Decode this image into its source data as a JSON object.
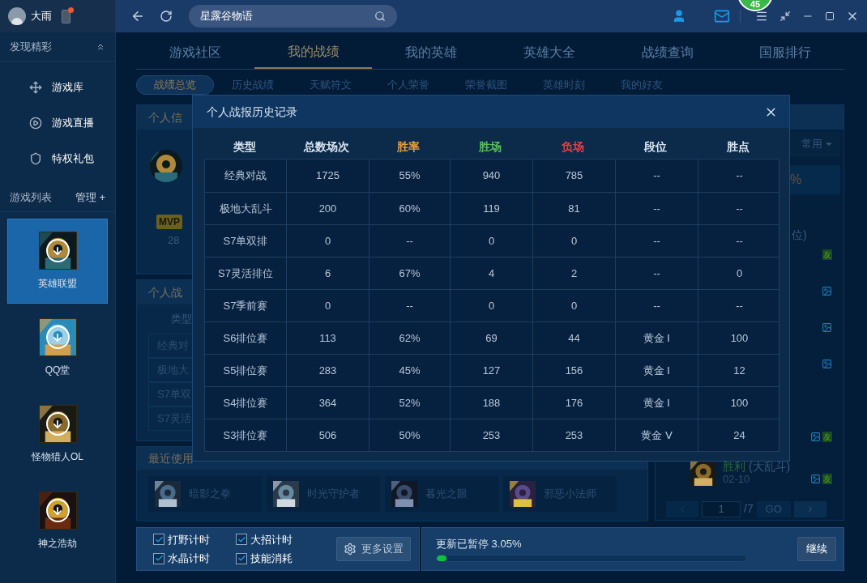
{
  "user": {
    "name": "大雨",
    "notification": true
  },
  "search": {
    "value": "星露谷物语"
  },
  "level_badge": "45",
  "sidebar": {
    "discover": {
      "title": "发现精彩",
      "expanded": true
    },
    "items": [
      "游戏库",
      "游戏直播",
      "特权礼包"
    ],
    "games_header": {
      "title": "游戏列表",
      "manage": "管理 +"
    },
    "games": [
      {
        "name": "英雄联盟",
        "selected": true
      },
      {
        "name": "QQ堂",
        "selected": false
      },
      {
        "name": "怪物猎人OL",
        "selected": false
      },
      {
        "name": "神之浩劫",
        "selected": false
      }
    ]
  },
  "nav_tabs": [
    {
      "label": "游戏社区",
      "selected": false
    },
    {
      "label": "我的战绩",
      "selected": true
    },
    {
      "label": "我的英雄",
      "selected": false
    },
    {
      "label": "英雄大全",
      "selected": false
    },
    {
      "label": "战绩查询",
      "selected": false
    },
    {
      "label": "国服排行",
      "selected": false
    }
  ],
  "sub_tabs": [
    {
      "label": "战绩总览",
      "selected": true
    },
    {
      "label": "历史战绩",
      "selected": false
    },
    {
      "label": "天赋符文",
      "selected": false
    },
    {
      "label": "个人荣誉",
      "selected": false
    },
    {
      "label": "荣誉截图",
      "selected": false
    },
    {
      "label": "英雄时刻",
      "selected": false
    },
    {
      "label": "我的好友",
      "selected": false
    }
  ],
  "profile_card": {
    "title": "个人信",
    "mvp": "MVP",
    "mvp_count": "28"
  },
  "report_card": {
    "title": "个人战",
    "column": "类型",
    "rows": [
      "经典对",
      "极地大",
      "S7单双",
      "S7灵活"
    ]
  },
  "recent": {
    "title": "最近使用",
    "heroes": [
      "暗影之拳",
      "时光守护者",
      "暮光之眼",
      "邪恶小法师"
    ]
  },
  "right_panel": {
    "filter": "常用",
    "summary": "%",
    "rows": [
      {
        "text": "位)",
        "screenshot": false,
        "tag": "友"
      },
      {
        "screenshot": true
      },
      {
        "screenshot": true
      },
      {
        "screenshot": true
      },
      {
        "screenshot": false
      },
      {
        "screenshot": true,
        "tag": "友"
      }
    ],
    "match": {
      "result": "胜利",
      "mode": "(大乱斗)",
      "date": "02-10",
      "screenshot": true,
      "tag": "友"
    },
    "pagination": {
      "page": "1",
      "total": "/7",
      "go": "GO"
    }
  },
  "modal": {
    "title": "个人战报历史记录",
    "columns": [
      {
        "label": "类型",
        "color": "#d8e4f0"
      },
      {
        "label": "总数场次",
        "color": "#d8e4f0"
      },
      {
        "label": "胜率",
        "color": "#e8a040"
      },
      {
        "label": "胜场",
        "color": "#5cc060"
      },
      {
        "label": "负场",
        "color": "#e84040"
      },
      {
        "label": "段位",
        "color": "#d8e4f0"
      },
      {
        "label": "胜点",
        "color": "#d8e4f0"
      }
    ],
    "rows": [
      [
        "经典对战",
        "1725",
        "55%",
        "940",
        "785",
        "--",
        "--"
      ],
      [
        "极地大乱斗",
        "200",
        "60%",
        "119",
        "81",
        "--",
        "--"
      ],
      [
        "S7单双排",
        "0",
        "--",
        "0",
        "0",
        "--",
        "--"
      ],
      [
        "S7灵活排位",
        "6",
        "67%",
        "4",
        "2",
        "--",
        "0"
      ],
      [
        "S7季前赛",
        "0",
        "--",
        "0",
        "0",
        "--",
        "--"
      ],
      [
        "S6排位赛",
        "113",
        "62%",
        "69",
        "44",
        "黄金 Ⅰ",
        "100"
      ],
      [
        "S5排位赛",
        "283",
        "45%",
        "127",
        "156",
        "黄金 Ⅰ",
        "12"
      ],
      [
        "S4排位赛",
        "364",
        "52%",
        "188",
        "176",
        "黄金 Ⅰ",
        "100"
      ],
      [
        "S3排位赛",
        "506",
        "50%",
        "253",
        "253",
        "黄金 Ⅴ",
        "24"
      ]
    ]
  },
  "settings": [
    {
      "label": "打野计时",
      "checked": true
    },
    {
      "label": "大招计时",
      "checked": true
    },
    {
      "label": "水晶计时",
      "checked": true
    },
    {
      "label": "技能消耗",
      "checked": true
    }
  ],
  "more_settings": "更多设置",
  "update": {
    "status": "更新已暂停 3.05%",
    "level": 0.0305,
    "button": "继续"
  }
}
